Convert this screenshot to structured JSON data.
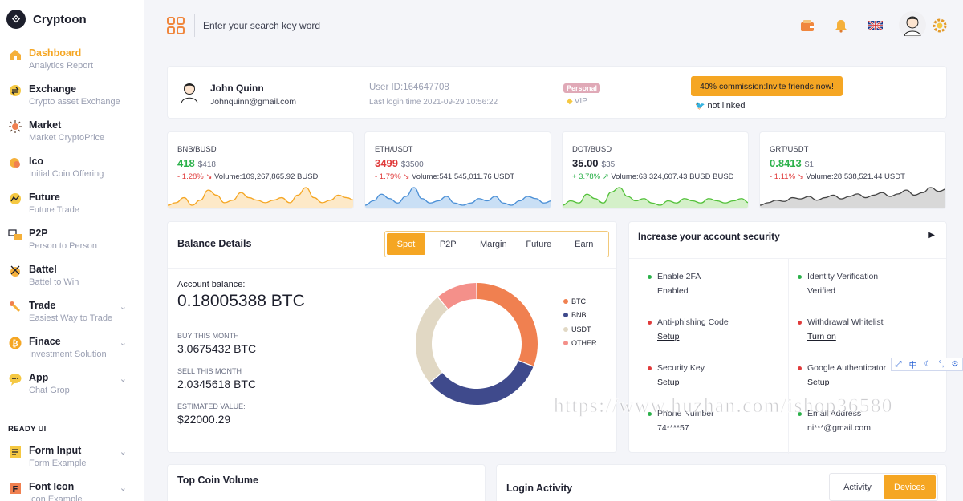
{
  "brand": {
    "name": "Cryptoon"
  },
  "sidebar": {
    "items": [
      {
        "label": "Dashboard",
        "sub": "Analytics Report",
        "icon": "house-icon",
        "active": true
      },
      {
        "label": "Exchange",
        "sub": "Crypto asset Exchange",
        "icon": "exchange-icon"
      },
      {
        "label": "Market",
        "sub": "Market CryptoPrice",
        "icon": "market-icon"
      },
      {
        "label": "Ico",
        "sub": "Initial Coin Offering",
        "icon": "ico-icon"
      },
      {
        "label": "Future",
        "sub": "Future Trade",
        "icon": "future-icon"
      },
      {
        "label": "P2P",
        "sub": "Person to Person",
        "icon": "p2p-icon"
      },
      {
        "label": "Battel",
        "sub": "Battel to Win",
        "icon": "battle-icon"
      },
      {
        "label": "Trade",
        "sub": "Easiest Way to Trade",
        "icon": "trade-icon",
        "expandable": true
      },
      {
        "label": "Finace",
        "sub": "Investment Solution",
        "icon": "bitcoin-icon",
        "expandable": true
      },
      {
        "label": "App",
        "sub": "Chat Grop",
        "icon": "chat-icon",
        "expandable": true
      }
    ],
    "section_label": "READY UI",
    "ready_items": [
      {
        "label": "Form Input",
        "sub": "Form Example",
        "icon": "form-icon",
        "expandable": true
      },
      {
        "label": "Font Icon",
        "sub": "Icon Example",
        "icon": "font-icon",
        "expandable": true
      }
    ]
  },
  "header": {
    "search_placeholder": "Enter your search key word",
    "icons": [
      "wallet-icon",
      "bell-icon",
      "uk-flag-icon",
      "avatar-icon",
      "settings-icon"
    ]
  },
  "profile": {
    "name": "John Quinn",
    "email": "Johnquinn@gmail.com",
    "user_id": "User ID:164647708",
    "last_login": "Last login time 2021-09-29 10:56:22",
    "badge": "Personal",
    "level": "VIP",
    "commission": "40% commission:Invite friends now!",
    "twitter": "not linked"
  },
  "tickers": [
    {
      "pair": "BNB/BUSD",
      "price": "418",
      "usd": "$418",
      "change": "- 1.28%",
      "volume": "Volume:109,267,865.92 BUSD",
      "price_color": "#2bb14a",
      "color": "#f5a623",
      "fill": "#fde9c8",
      "trend": [
        6,
        7,
        9,
        6,
        8,
        12,
        10,
        7,
        8,
        11,
        9,
        8,
        7,
        8,
        9,
        7,
        10,
        13,
        9,
        7,
        8,
        10,
        9,
        8
      ]
    },
    {
      "pair": "ETH/USDT",
      "price": "3499",
      "usd": "$3500",
      "change": "- 1.79%",
      "volume": "Volume:541,545,011.76 USDT",
      "price_color": "#e03b3b",
      "color": "#4a8fd6",
      "fill": "#c9dff5",
      "trend": [
        8,
        10,
        13,
        11,
        9,
        12,
        16,
        11,
        9,
        10,
        12,
        9,
        8,
        9,
        11,
        10,
        12,
        9,
        8,
        10,
        12,
        11,
        9,
        10
      ]
    },
    {
      "pair": "DOT/BUSD",
      "price": "35.00",
      "usd": "$35",
      "change": "+ 3.78%",
      "volume": "Volume:63,324,607.43 BUSD BUSD",
      "price_color": "#1d1f2c",
      "color": "#53c13a",
      "fill": "#d4f0c9",
      "trend": [
        7,
        9,
        8,
        12,
        10,
        8,
        13,
        15,
        11,
        9,
        10,
        8,
        7,
        9,
        8,
        10,
        9,
        8,
        10,
        9,
        8,
        9,
        10,
        8
      ]
    },
    {
      "pair": "GRT/USDT",
      "price": "0.8413",
      "usd": "$1",
      "change": "- 1.11%",
      "volume": "Volume:28,538,521.44 USDT",
      "price_color": "#2bb14a",
      "color": "#444",
      "fill": "#d8d8d8",
      "trend": [
        6,
        8,
        10,
        9,
        12,
        11,
        13,
        10,
        12,
        14,
        11,
        13,
        15,
        12,
        14,
        16,
        13,
        15,
        18,
        14,
        16,
        20,
        17,
        19
      ]
    }
  ],
  "balance": {
    "title": "Balance Details",
    "tabs": [
      "Spot",
      "P2P",
      "Margin",
      "Future",
      "Earn"
    ],
    "active_tab": "Spot",
    "account_label": "Account balance:",
    "account_value": "0.18005388 BTC",
    "buy_label": "BUY THIS MONTH",
    "buy_value": "3.0675432 BTC",
    "sell_label": "SELL THIS MONTH",
    "sell_value": "2.0345618 BTC",
    "est_label": "ESTIMATED VALUE:",
    "est_value": "$22000.29"
  },
  "chart_data": {
    "type": "pie",
    "categories": [
      "BTC",
      "BNB",
      "USDT",
      "OTHER"
    ],
    "values": [
      31,
      33,
      25,
      11
    ],
    "colors": [
      "#f08050",
      "#3f4a8c",
      "#e1d8c4",
      "#f4908a"
    ]
  },
  "security": {
    "title": "Increase your account security",
    "items": [
      {
        "label": "Enable 2FA",
        "sub": "Enabled",
        "dot": "#2bb14a",
        "link": false
      },
      {
        "label": "Identity Verification",
        "sub": "Verified",
        "dot": "#2bb14a",
        "link": false
      },
      {
        "label": "Anti-phishing Code",
        "sub": "Setup",
        "dot": "#e03b3b",
        "link": true
      },
      {
        "label": "Withdrawal Whitelist",
        "sub": "Turn on",
        "dot": "#e03b3b",
        "link": true
      },
      {
        "label": "Security Key",
        "sub": "Setup",
        "dot": "#e03b3b",
        "link": true
      },
      {
        "label": "Google Authenticator",
        "sub": "Setup",
        "dot": "#e03b3b",
        "link": true
      },
      {
        "label": "Phone Number",
        "sub": "74****57",
        "dot": "#2bb14a",
        "link": false
      },
      {
        "label": "Email Address",
        "sub": "ni***@gmail.com",
        "dot": "#2bb14a",
        "link": false
      }
    ]
  },
  "ime_toolbar": {
    "text": "中"
  },
  "watermark": "https://www.huzhan.com/ishop36580",
  "top_coin": {
    "title": "Top Coin Volume"
  },
  "login_activity": {
    "title": "Login Activity",
    "tabs": [
      "Activity",
      "Devices"
    ],
    "active_tab": "Devices"
  }
}
